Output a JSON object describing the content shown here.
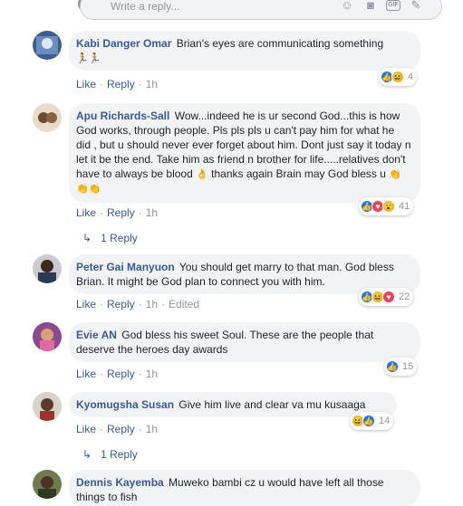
{
  "reply_box": {
    "placeholder": "Write a reply..."
  },
  "actions": {
    "like": "Like",
    "reply": "Reply"
  },
  "comments": [
    {
      "author": "Kabi Danger Omar",
      "text": "Brian's eyes are communicating something",
      "time": "1h",
      "edited": "",
      "reactions": [
        "like",
        "haha"
      ],
      "count": "4"
    },
    {
      "author": "Apu Richards-Sall",
      "text": "Wow...indeed he is ur second God...this is how God works, through people. Pls pls pls u can't pay him for what he did , but u should never ever forget about him. Dont just say it today n let it be the end. Take him as friend n brother for life.....relatives don't have to always be blood",
      "text_tail": "thanks again Brain may God bless u",
      "time": "1h",
      "edited": "",
      "reactions": [
        "like",
        "love",
        "wow"
      ],
      "count": "41"
    },
    {
      "author": "Peter Gai Manyuon",
      "text": "You should get marry to that man. God bless Brian. It might be God plan to connect you with him.",
      "time": "1h",
      "edited": "Edited",
      "reactions": [
        "like",
        "haha",
        "love"
      ],
      "count": "22"
    },
    {
      "author": "Evie AN",
      "text": "God bless his sweet Soul. These are the people that deserve the heroes day awards",
      "time": "1h",
      "edited": "",
      "reactions": [
        "like"
      ],
      "count": "15"
    },
    {
      "author": "Kyomugsha Susan",
      "text": "Give him live and clear va mu kusaaga",
      "time": "1h",
      "edited": "",
      "reactions": [
        "haha",
        "like"
      ],
      "count": "14"
    },
    {
      "author": "Dennis Kayemba",
      "text": "Muweko bambi cz u would have left all those things to fish",
      "time": "",
      "edited": "",
      "reactions": [],
      "count": ""
    }
  ],
  "reply_links": [
    "1 Reply",
    "1 Reply"
  ],
  "colors": {
    "link": "#385898",
    "bubble": "#f2f3f5",
    "meta": "#90949c",
    "like": "#1877f2",
    "love": "#f33e58",
    "haha": "#f7b125"
  }
}
